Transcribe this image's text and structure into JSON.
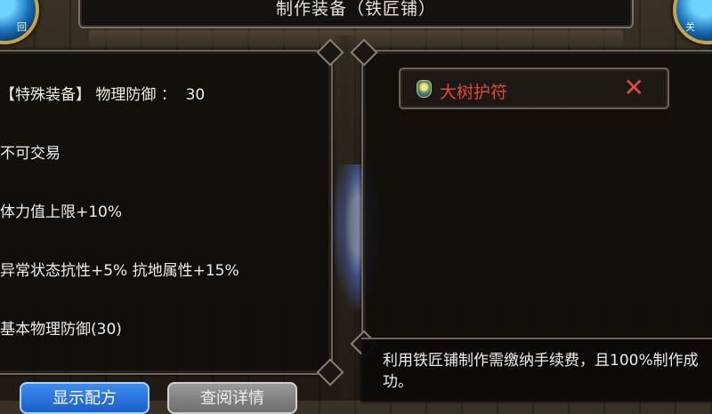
{
  "title": "制作装备（铁匠铺）",
  "left_orb_label": "回",
  "right_orb_label": "关",
  "equipment_attributes": [
    "【特殊装备】 物理防御 ：  30",
    "不可交易",
    "体力值上限+10%",
    "异常状态抗性+5% 抗地属性+15%",
    "基本物理防御(30)"
  ],
  "selected_item": {
    "name": "大树护符",
    "icon": "amulet-icon",
    "close_icon": "close-x-icon"
  },
  "description": "利用铁匠铺制作需缴纳手续费，且100%制作成功。",
  "buttons": {
    "show_recipe": "显示配方",
    "view_details": "查阅详情"
  },
  "colors": {
    "item_name": "#e0493a",
    "close_icon": "#e04848",
    "primary_button": "#2a74e0",
    "disabled_button": "#848484"
  }
}
